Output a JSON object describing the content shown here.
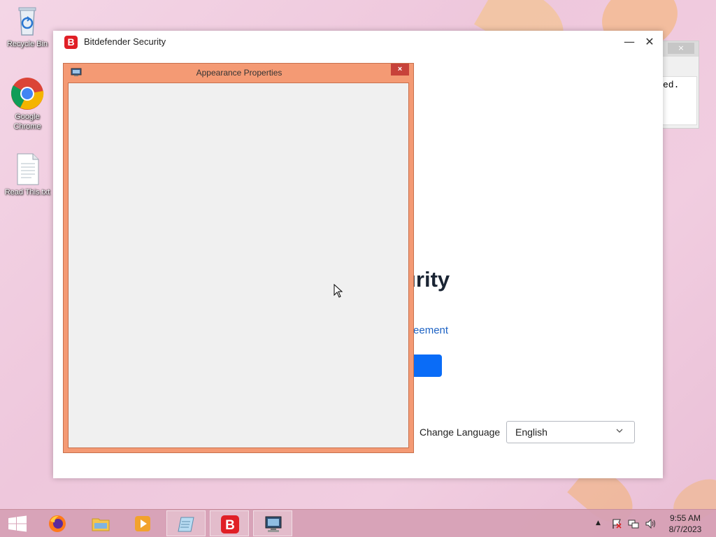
{
  "desktop": {
    "icons": [
      {
        "label": "Recycle Bin"
      },
      {
        "label": "Google Chrome"
      },
      {
        "label": "Read This.txt"
      }
    ]
  },
  "background_window": {
    "text": "ed.",
    "close_label": "×"
  },
  "bitdefender": {
    "title": "Bitdefender Security",
    "logo_letter": "B",
    "minimize_label": "—",
    "close_label": "✕",
    "heading_partial": "urity",
    "agreement_link_partial": "n Agreement",
    "change_language_label": "Change Language",
    "language_value": "English",
    "brand_color": "#e01f26",
    "accent_color": "#0a6cf7"
  },
  "appearance_properties": {
    "title": "Appearance Properties",
    "close_label": "×",
    "frame_color": "#f49a74"
  },
  "taskbar": {
    "items": [
      {
        "name": "firefox"
      },
      {
        "name": "file-explorer"
      },
      {
        "name": "media-player"
      },
      {
        "name": "notepad"
      },
      {
        "name": "bitdefender"
      },
      {
        "name": "appearance-properties"
      }
    ],
    "clock": {
      "time": "9:55 AM",
      "date": "8/7/2023"
    }
  }
}
